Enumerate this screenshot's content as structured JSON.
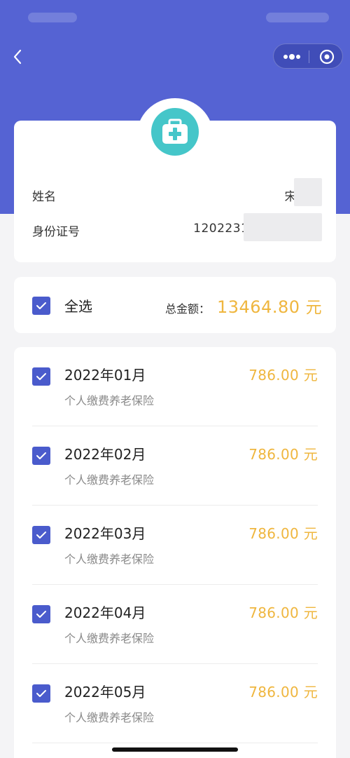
{
  "nav": {
    "back_icon": "chevron-left-icon",
    "more_icon": "more-dots-icon",
    "close_icon": "target-close-icon"
  },
  "header": {
    "icon": "medical-kit-icon",
    "accent_color": "#5563d3",
    "icon_color": "#45c6c9"
  },
  "info": {
    "name_label": "姓名",
    "name_value": "宋",
    "id_label": "身份证号",
    "id_value": "1202231​98"
  },
  "summary": {
    "select_all_label": "全选",
    "select_all_checked": true,
    "total_label": "总金额：",
    "total_amount": "13464.80",
    "currency": "元",
    "amount_color": "#efb63e"
  },
  "items": [
    {
      "month": "2022年01月",
      "desc": "个人缴费养老保险",
      "amount": "786.00",
      "currency": "元",
      "checked": true
    },
    {
      "month": "2022年02月",
      "desc": "个人缴费养老保险",
      "amount": "786.00",
      "currency": "元",
      "checked": true
    },
    {
      "month": "2022年03月",
      "desc": "个人缴费养老保险",
      "amount": "786.00",
      "currency": "元",
      "checked": true
    },
    {
      "month": "2022年04月",
      "desc": "个人缴费养老保险",
      "amount": "786.00",
      "currency": "元",
      "checked": true
    },
    {
      "month": "2022年05月",
      "desc": "个人缴费养老保险",
      "amount": "786.00",
      "currency": "元",
      "checked": true
    }
  ]
}
